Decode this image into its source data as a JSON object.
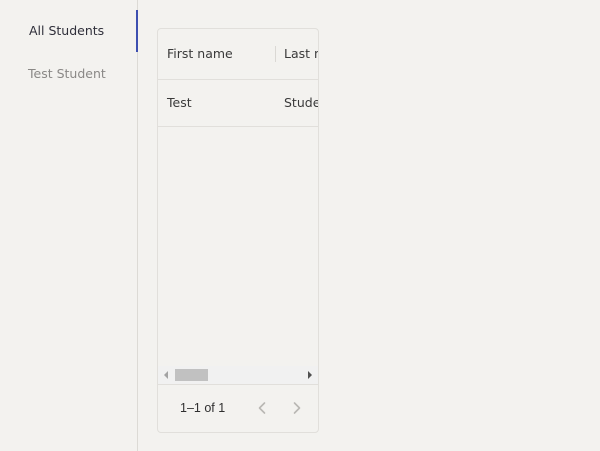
{
  "sidebar": {
    "items": [
      {
        "label": "All Students",
        "active": true
      },
      {
        "label": "Test Student",
        "active": false
      }
    ]
  },
  "grid": {
    "columns": [
      "First name",
      "Last name"
    ],
    "rows": [
      [
        "Test",
        "Student"
      ]
    ],
    "footer": {
      "page_info": "1–1 of 1",
      "prev_icon": "chevron-left-icon",
      "next_icon": "chevron-right-icon"
    }
  },
  "colors": {
    "background": "#f3f2ef",
    "active_indicator": "#3d4fb0",
    "border": "#e1dfdb",
    "muted_text": "#8a8886"
  }
}
